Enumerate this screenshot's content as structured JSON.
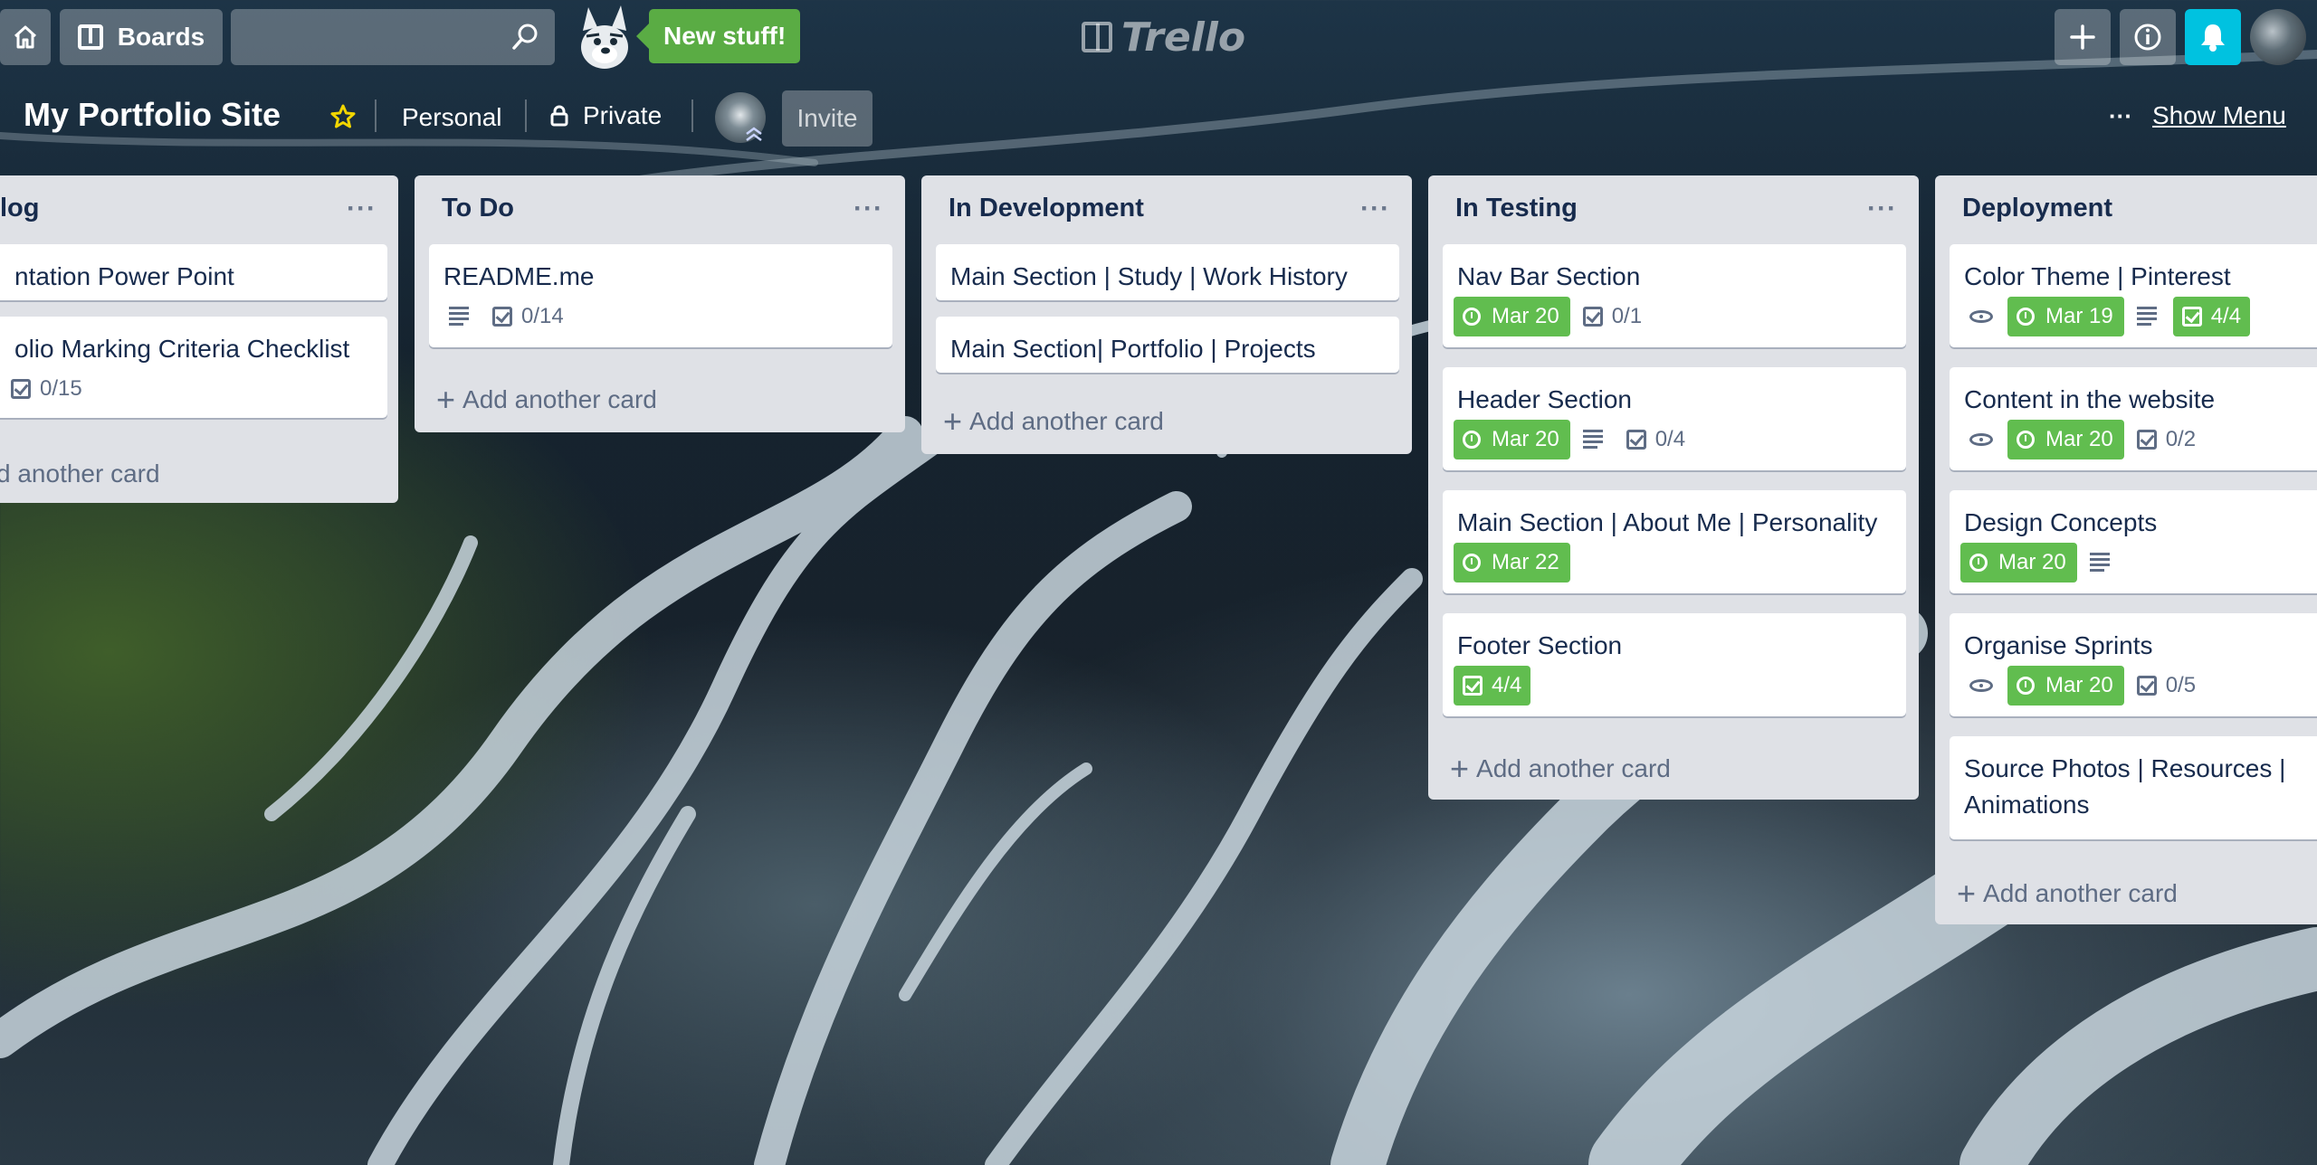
{
  "header": {
    "home_icon": "home-icon",
    "boards_label": "Boards",
    "search": {
      "placeholder": "",
      "value": ""
    },
    "new_stuff_label": "New stuff!",
    "logo_text": "Trello"
  },
  "board": {
    "title": "My Portfolio Site",
    "team": "Personal",
    "visibility": "Private",
    "invite_label": "Invite",
    "show_menu_label": "Show Menu",
    "more_label": "···"
  },
  "lists": [
    {
      "title": "Backlog",
      "visible_title": "log",
      "cards": [
        {
          "title": "ntation Power Point"
        },
        {
          "title": "olio Marking Criteria Checklist",
          "checklist": "0/15"
        }
      ],
      "add_label": "d another card"
    },
    {
      "title": "To Do",
      "cards": [
        {
          "title": "README.me",
          "description": true,
          "checklist": "0/14"
        }
      ],
      "add_label": "Add another card"
    },
    {
      "title": "In Development",
      "cards": [
        {
          "title": "Main Section | Study | Work History"
        },
        {
          "title": "Main Section| Portfolio | Projects"
        }
      ],
      "add_label": "Add another card"
    },
    {
      "title": "In Testing",
      "cards": [
        {
          "title": "Nav Bar Section",
          "due": "Mar 20",
          "checklist": "0/1"
        },
        {
          "title": "Header Section",
          "due": "Mar 20",
          "description": true,
          "checklist": "0/4"
        },
        {
          "title": "Main Section | About Me | Personality",
          "due": "Mar 22"
        },
        {
          "title": "Footer Section",
          "checklist_done": "4/4"
        }
      ],
      "add_label": "Add another card"
    },
    {
      "title": "Deployment",
      "cards": [
        {
          "title": "Color Theme | Pinterest",
          "watch": true,
          "due": "Mar 19",
          "description": true,
          "checklist_done": "4/4"
        },
        {
          "title": "Content in the website",
          "watch": true,
          "due": "Mar 20",
          "checklist": "0/2"
        },
        {
          "title": "Design Concepts",
          "due": "Mar 20",
          "description": true
        },
        {
          "title": "Organise Sprints",
          "watch": true,
          "due": "Mar 20",
          "checklist": "0/5"
        },
        {
          "title_line1": "Source Photos | Resources |",
          "title_line2": "Animations"
        }
      ],
      "add_label": "Add another card"
    }
  ],
  "colors": {
    "badge_green": "#61bd4f",
    "list_bg": "#dfe1e6",
    "notification_blue": "#00c2e0"
  }
}
